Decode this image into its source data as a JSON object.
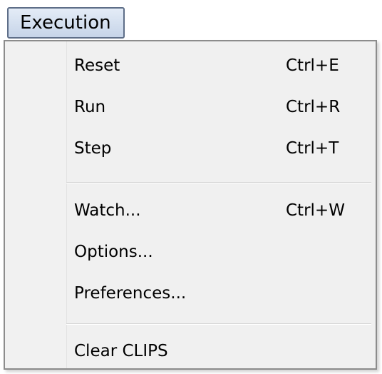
{
  "menubar": {
    "label": "Execution"
  },
  "menu": {
    "items": [
      {
        "label": "Reset",
        "shortcut": "Ctrl+E"
      },
      {
        "label": "Run",
        "shortcut": "Ctrl+R"
      },
      {
        "label": "Step",
        "shortcut": "Ctrl+T"
      },
      {
        "label": "Watch...",
        "shortcut": "Ctrl+W"
      },
      {
        "label": "Options...",
        "shortcut": ""
      },
      {
        "label": "Preferences...",
        "shortcut": ""
      },
      {
        "label": "Clear CLIPS",
        "shortcut": ""
      }
    ]
  }
}
